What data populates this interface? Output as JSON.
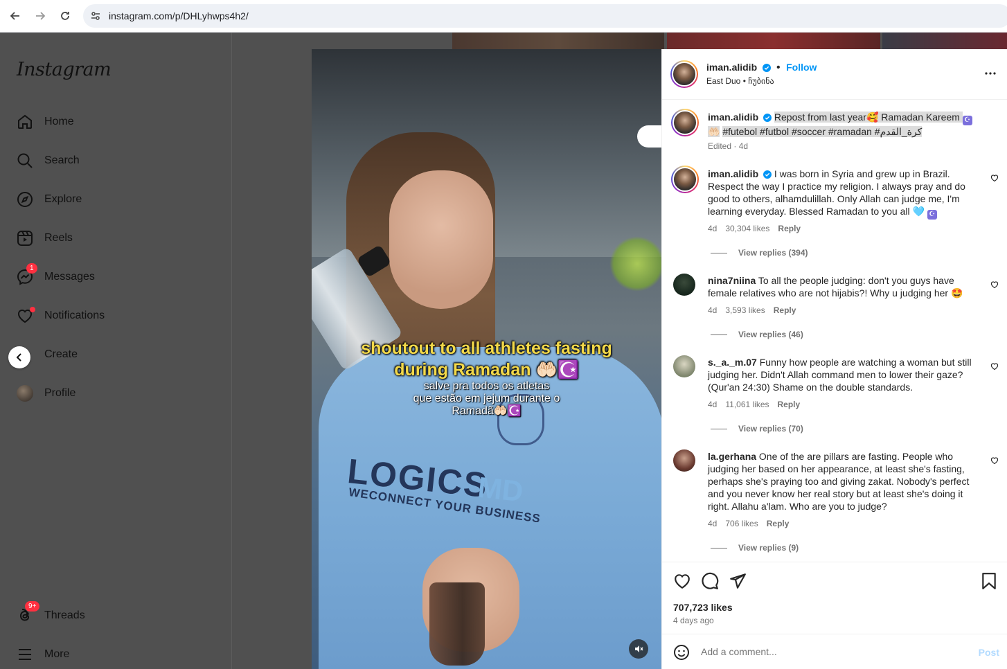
{
  "browser": {
    "url": "instagram.com/p/DHLyhwps4h2/"
  },
  "sidebar": {
    "logo": "Instagram",
    "items": [
      {
        "label": "Home",
        "icon": "home-icon"
      },
      {
        "label": "Search",
        "icon": "search-icon"
      },
      {
        "label": "Explore",
        "icon": "compass-icon"
      },
      {
        "label": "Reels",
        "icon": "reels-icon"
      },
      {
        "label": "Messages",
        "icon": "messenger-icon",
        "badge": "1"
      },
      {
        "label": "Notifications",
        "icon": "heart-icon"
      },
      {
        "label": "Create",
        "icon": "plus-icon"
      },
      {
        "label": "Profile",
        "icon": "avatar"
      }
    ],
    "threads": {
      "label": "Threads",
      "badge": "9+"
    },
    "more": {
      "label": "More"
    }
  },
  "media": {
    "overlay_line1": "shoutout to all athletes fasting",
    "overlay_line2": "during Ramadan 🤲🏻☪️",
    "sub_line1": "salve pra todos os atletas",
    "sub_line2": "que estão em jejum durante o",
    "sub_line3": "Ramadã🤲🏻☪️",
    "shirt_brand": "LOGICS",
    "shirt_md": "MD",
    "shirt_tagline": "WECONNECT YOUR BUSINESS"
  },
  "post": {
    "username": "iman.alidib",
    "follow_label": "Follow",
    "location": "East Duo • ჩუბინა",
    "caption_lead": "Repost from last year🥰  Ramadan Kareem ",
    "caption_tail": " 🤲🏻",
    "caption_tags": "#futebol #futbol #soccer #ramadan #كرة_القدم",
    "edited": "Edited · 4d",
    "likes": "707,723 likes",
    "time_ago": "4 days ago",
    "add_comment_placeholder": "Add a comment...",
    "post_label": "Post"
  },
  "comments": [
    {
      "username": "iman.alidib",
      "verified": true,
      "text": "I was born in Syria and grew up in Brazil. Respect the way I practice my religion. I always pray and do good to others, alhamdulillah. Only Allah can judge me, I'm learning everyday. Blessed Ramadan to you all 🩵 ",
      "age": "4d",
      "likes": "30,304 likes",
      "reply": "Reply",
      "view_replies": "View replies (394)"
    },
    {
      "username": "nina7niina",
      "text": "To all the people judging: don't you guys have female relatives who are not hijabis?! Why u judging her 🤩",
      "age": "4d",
      "likes": "3,593 likes",
      "reply": "Reply",
      "view_replies": "View replies (46)"
    },
    {
      "username": "s._a._m.07",
      "text": "Funny how people are watching a woman but still judging her. Didn't Allah command men to lower their gaze? (Qur'an 24:30) Shame on the double standards.",
      "age": "4d",
      "likes": "11,061 likes",
      "reply": "Reply",
      "view_replies": "View replies (70)"
    },
    {
      "username": "la.gerhana",
      "text": "One of the are pillars are fasting. People who judging her based on her appearance, at least she's fasting, perhaps she's praying too and giving zakat. Nobody's perfect and you never know her real story but at least she's doing it right. Allahu a'lam. Who are you to judge?",
      "age": "4d",
      "likes": "706 likes",
      "reply": "Reply",
      "view_replies": "View replies (9)"
    }
  ],
  "colors": {
    "accent": "#0095f6",
    "badge": "#ff3040",
    "dim_overlay": "#505050"
  }
}
